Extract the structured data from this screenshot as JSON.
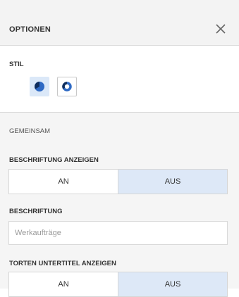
{
  "header": {
    "title": "OPTIONEN",
    "close_icon": "close-icon"
  },
  "stil": {
    "label": "STIL",
    "options": [
      {
        "icon": "pie-chart-icon",
        "selected": true
      },
      {
        "icon": "donut-chart-icon",
        "selected": false
      }
    ]
  },
  "common": {
    "heading": "GEMEINSAM",
    "show_labels": {
      "label": "BESCHRIFTUNG ANZEIGEN",
      "on": "AN",
      "off": "AUS",
      "selected": "AUS"
    },
    "caption": {
      "label": "BESCHRIFTUNG",
      "placeholder": "Werkaufträge",
      "value": ""
    },
    "show_pie_subtitles": {
      "label": "TORTEN UNTERTITEL ANZEIGEN",
      "on": "AN",
      "off": "AUS",
      "selected": "AUS"
    }
  },
  "colors": {
    "header_bg": "#f3f3f3",
    "selected_bg": "#dde8f7",
    "pie_icon": "#2f6ac4",
    "panel_bg": "#f5f5f5"
  }
}
